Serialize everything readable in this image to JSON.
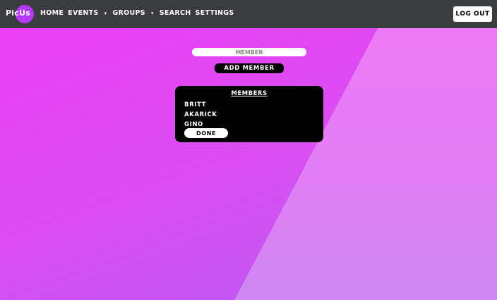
{
  "app": {
    "logo_text": "PicUs",
    "brand_color": "#b43af5"
  },
  "nav": {
    "items": [
      {
        "label": "HOME"
      },
      {
        "label": "EVENTS",
        "has_dropdown": true
      },
      {
        "label": "GROUPS",
        "has_dropdown": true
      },
      {
        "label": "SEARCH"
      },
      {
        "label": "SETTINGS"
      }
    ],
    "dropdown_glyph": "▾",
    "logout_label": "LOG OUT"
  },
  "form": {
    "member_placeholder": "MEMBER",
    "add_member_label": "ADD MEMBER"
  },
  "members_panel": {
    "title": "MEMBERS",
    "members": [
      "BRITT",
      "AKARICK",
      "GINO"
    ],
    "done_label": "DONE"
  }
}
